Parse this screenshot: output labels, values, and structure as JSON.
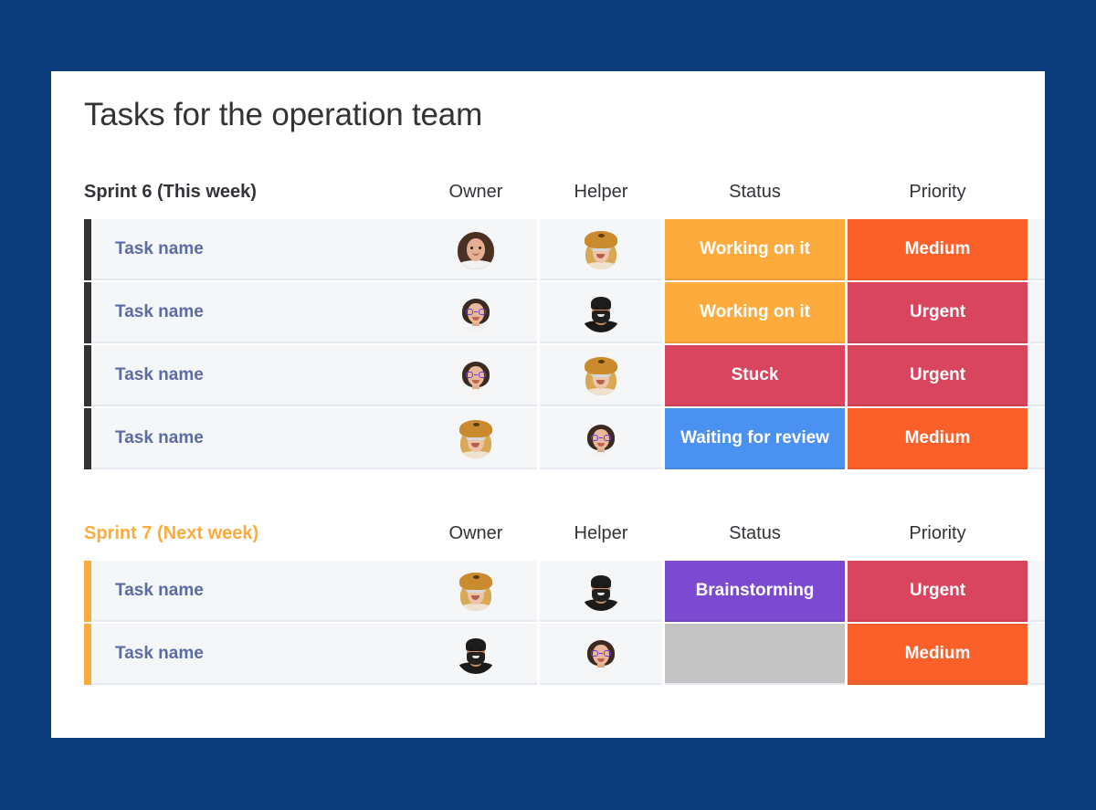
{
  "theme": {
    "page_background": "#0c3c7c",
    "card_background": "#ffffff",
    "cell_background": "#f5f6f8",
    "task_text_color": "#5b6ba6",
    "sprint6_bar_color": "#333333",
    "sprint7_bar_color": "#fdab3d"
  },
  "header": {
    "title": "Tasks for the operation team"
  },
  "columns": {
    "owner": "Owner",
    "helper": "Helper",
    "status": "Status",
    "priority": "Priority"
  },
  "groups": [
    {
      "title": "Sprint 6 (This week)",
      "title_color": "#323338",
      "bar_color": "#333333",
      "rows": [
        {
          "name": "Task name",
          "owner_avatar": "avatar-brunette-woman",
          "helper_avatar": "avatar-blonde-fur-hat",
          "status": {
            "label": "Working on it",
            "color": "#fdab3d"
          },
          "priority": {
            "label": "Medium",
            "color": "#fb602a"
          }
        },
        {
          "name": "Task name",
          "owner_avatar": "avatar-woman-glasses",
          "helper_avatar": "avatar-bearded-man",
          "status": {
            "label": "Working on it",
            "color": "#fdab3d"
          },
          "priority": {
            "label": "Urgent",
            "color": "#d9455f"
          }
        },
        {
          "name": "Task name",
          "owner_avatar": "avatar-woman-glasses",
          "helper_avatar": "avatar-blonde-fur-hat",
          "status": {
            "label": "Stuck",
            "color": "#d9455f"
          },
          "priority": {
            "label": "Urgent",
            "color": "#d9455f"
          }
        },
        {
          "name": "Task name",
          "owner_avatar": "avatar-blonde-fur-hat",
          "helper_avatar": "avatar-woman-glasses",
          "status": {
            "label": "Waiting for review",
            "color": "#4b91f1"
          },
          "priority": {
            "label": "Medium",
            "color": "#fb602a"
          }
        }
      ]
    },
    {
      "title": "Sprint 7 (Next week)",
      "title_color": "#fdab3d",
      "bar_color": "#fdab3d",
      "rows": [
        {
          "name": "Task name",
          "owner_avatar": "avatar-blonde-fur-hat",
          "helper_avatar": "avatar-bearded-man",
          "status": {
            "label": "Brainstorming",
            "color": "#7b4ad1"
          },
          "priority": {
            "label": "Urgent",
            "color": "#d9455f"
          }
        },
        {
          "name": "Task name",
          "owner_avatar": "avatar-bearded-man",
          "helper_avatar": "avatar-woman-glasses",
          "status": {
            "label": "",
            "color": "#c4c4c4"
          },
          "priority": {
            "label": "Medium",
            "color": "#fb602a"
          }
        }
      ]
    }
  ]
}
